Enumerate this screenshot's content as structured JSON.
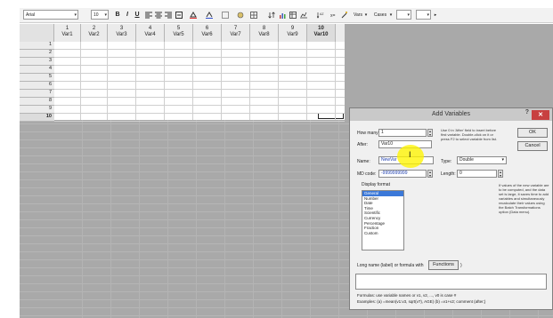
{
  "toolbar": {
    "font": "Arial",
    "font_size": "10",
    "bold": "B",
    "italic": "I",
    "underline": "U",
    "vars_label": "Vars",
    "cases_label": "Cases"
  },
  "grid": {
    "columns": [
      {
        "num": "1",
        "name": "Var1"
      },
      {
        "num": "2",
        "name": "Var2"
      },
      {
        "num": "3",
        "name": "Var3"
      },
      {
        "num": "4",
        "name": "Var4"
      },
      {
        "num": "5",
        "name": "Var5"
      },
      {
        "num": "6",
        "name": "Var6"
      },
      {
        "num": "7",
        "name": "Var7"
      },
      {
        "num": "8",
        "name": "Var8"
      },
      {
        "num": "9",
        "name": "Var9"
      },
      {
        "num": "10",
        "name": "Var10"
      }
    ],
    "rows": [
      "1",
      "2",
      "3",
      "4",
      "5",
      "6",
      "7",
      "8",
      "9",
      "10"
    ],
    "selected_column": 10,
    "selected_row": 10
  },
  "dialog": {
    "title": "Add Variables",
    "help": "?",
    "close": "✕",
    "how_many_label": "How many:",
    "how_many_value": "1",
    "after_label": "After:",
    "after_value": "Var10",
    "name_label": "Name:",
    "name_value": "NewVar",
    "type_label": "Type:",
    "type_value": "Double",
    "md_code_label": "MD code:",
    "md_code_value": "-9999999999",
    "length_label": "Length:",
    "length_value": "0",
    "hint_text": "Use 0 in 'After' field to insert before first variable. Double-click on it or press F2 to select variable from list.",
    "ok_label": "OK",
    "cancel_label": "Cancel",
    "display_format_label": "Display format",
    "formats": [
      "General",
      "Number",
      "Date",
      "Time",
      "Scientific",
      "Currency",
      "Percentage",
      "Fraction",
      "Custom"
    ],
    "selected_format": "General",
    "side_note": "If values of the new variable are to be computed, and the data set is large, it saves time to add variables and simultaneously recalculate their values using the Batch Transformations option (Data menu).",
    "long_name_label": "Long name (label) or formula with",
    "functions_label": "Functions",
    "long_name_suffix": ")",
    "formulas_text": "Formulas: use variable names or v1, v2, ..., v0 is case #",
    "examples_text": "Examples:  (a) =mean(v1:v3, sqrt(v7), AGE)  (b) =v1+v2; comment (after;)"
  },
  "colors": {
    "grid_bg": "#a9a9a9",
    "highlight": "#fff500",
    "close_button": "#c84040",
    "selected_format": "#3b78d8"
  }
}
